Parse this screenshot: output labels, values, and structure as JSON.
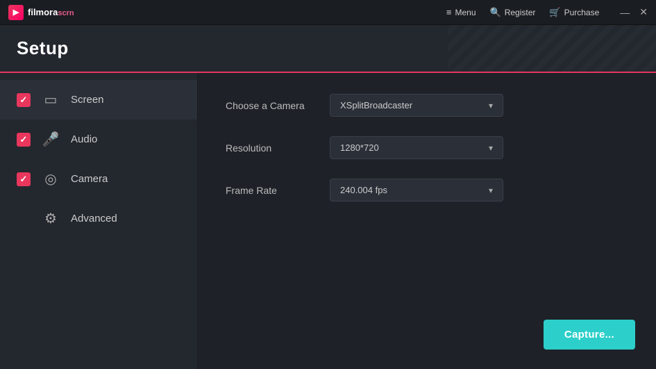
{
  "app": {
    "logo_primary": "filmora",
    "logo_secondary": "scrn",
    "title": "Setup"
  },
  "titlebar": {
    "menu_label": "Menu",
    "register_label": "Register",
    "purchase_label": "Purchase",
    "minimize_label": "—",
    "close_label": "✕"
  },
  "sidebar": {
    "items": [
      {
        "id": "screen",
        "label": "Screen",
        "checked": true,
        "icon": "🖥"
      },
      {
        "id": "audio",
        "label": "Audio",
        "checked": true,
        "icon": "🎤"
      },
      {
        "id": "camera",
        "label": "Camera",
        "checked": true,
        "icon": "⊙"
      },
      {
        "id": "advanced",
        "label": "Advanced",
        "checked": false,
        "icon": "⚙"
      }
    ]
  },
  "form": {
    "camera_label": "Choose a Camera",
    "camera_value": "XSplitBroadcaster",
    "resolution_label": "Resolution",
    "resolution_value": "1280*720",
    "framerate_label": "Frame Rate",
    "framerate_value": "240.004 fps",
    "capture_button": "Capture..."
  },
  "colors": {
    "accent": "#e8365d",
    "capture": "#2dcfca"
  }
}
